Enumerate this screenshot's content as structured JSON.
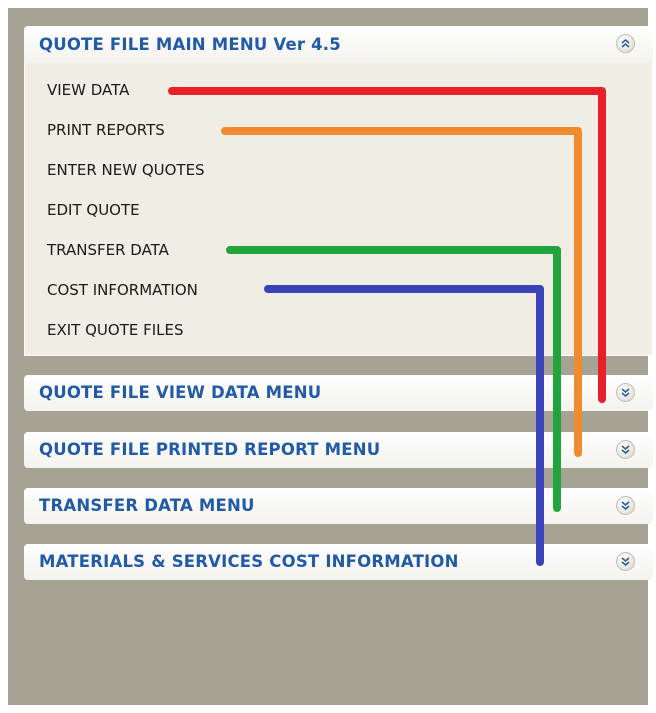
{
  "main_menu": {
    "title": "QUOTE FILE MAIN MENU Ver 4.5",
    "collapse_icon": "chevron-double-up-icon",
    "items": [
      {
        "label": "VIEW DATA"
      },
      {
        "label": "PRINT REPORTS"
      },
      {
        "label": "ENTER NEW QUOTES"
      },
      {
        "label": "EDIT QUOTE"
      },
      {
        "label": "TRANSFER DATA"
      },
      {
        "label": "COST INFORMATION"
      },
      {
        "label": "EXIT QUOTE FILES"
      }
    ]
  },
  "sub_menus": [
    {
      "title": "QUOTE FILE VIEW DATA MENU",
      "expand_icon": "chevron-double-down-icon"
    },
    {
      "title": "QUOTE FILE PRINTED REPORT MENU",
      "expand_icon": "chevron-double-down-icon"
    },
    {
      "title": "TRANSFER DATA MENU",
      "expand_icon": "chevron-double-down-icon"
    },
    {
      "title": "MATERIALS & SERVICES COST INFORMATION",
      "expand_icon": "chevron-double-down-icon"
    }
  ],
  "connector_colors": {
    "view_data": "#e8202a",
    "print_reports": "#f28b30",
    "transfer_data": "#22a43c",
    "cost_information": "#3a44b8"
  },
  "colors": {
    "header_text": "#215aa8",
    "panel_background": "#a6a394",
    "menu_background": "#efede4"
  }
}
